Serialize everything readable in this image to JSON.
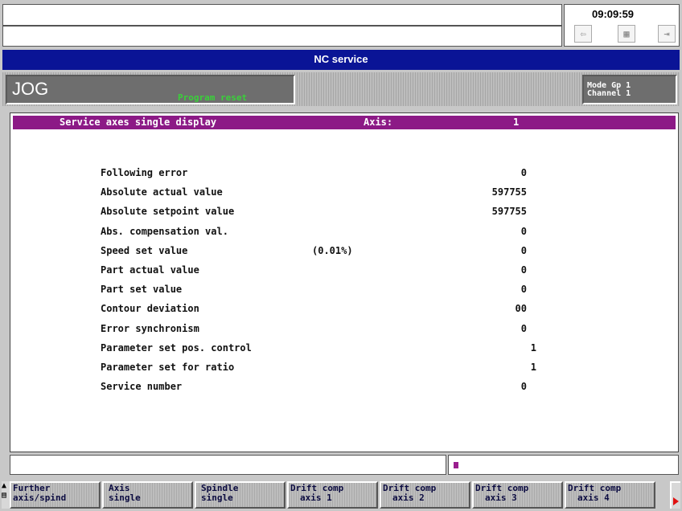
{
  "header": {
    "status_line_1": "",
    "status_line_2": "",
    "clock": "09:09:59"
  },
  "title_bar": {
    "title": "NC service"
  },
  "mode_band": {
    "mode": "JOG",
    "program_status": "Program reset",
    "mode_group": "Mode Gp 1",
    "channel": "Channel 1"
  },
  "panel": {
    "heading": "Service axes single display",
    "axis_label": "Axis:",
    "axis_number": "1",
    "rows": [
      {
        "label": "Following error",
        "note": "",
        "value": "0"
      },
      {
        "label": "Absolute actual value",
        "note": "",
        "value": "597755"
      },
      {
        "label": "Absolute setpoint value",
        "note": "",
        "value": "597755"
      },
      {
        "label": "Abs. compensation val.",
        "note": "",
        "value": "0"
      },
      {
        "label": "Speed set value",
        "note": "(0.01%)",
        "value": "0"
      },
      {
        "label": "Part actual value",
        "note": "",
        "value": "0"
      },
      {
        "label": "Part set value",
        "note": "",
        "value": "0"
      },
      {
        "label": "Contour deviation",
        "note": "",
        "value": "00"
      },
      {
        "label": "Error synchronism",
        "note": "",
        "value": "0"
      },
      {
        "label": "Parameter set pos. control",
        "note": "",
        "value": "1"
      },
      {
        "label": "Parameter set for ratio",
        "note": "",
        "value": "1"
      },
      {
        "label": "Service number",
        "note": "",
        "value": "0"
      }
    ]
  },
  "bottom": {
    "message_left": "",
    "message_right": ""
  },
  "softkeys": [
    {
      "line1": "Further",
      "line2": "axis/spind"
    },
    {
      "line1": "Axis",
      "line2": "single"
    },
    {
      "line1": "Spindle",
      "line2": "single"
    },
    {
      "line1": "Drift comp",
      "line2": "axis 1"
    },
    {
      "line1": "Drift comp",
      "line2": "axis 2"
    },
    {
      "line1": "Drift comp",
      "line2": "axis 3"
    },
    {
      "line1": "Drift comp",
      "line2": "axis 4"
    }
  ],
  "colors": {
    "title_bar": "#0a1496",
    "heading_bar": "#8c1a86",
    "program_status": "#3ad03a"
  }
}
